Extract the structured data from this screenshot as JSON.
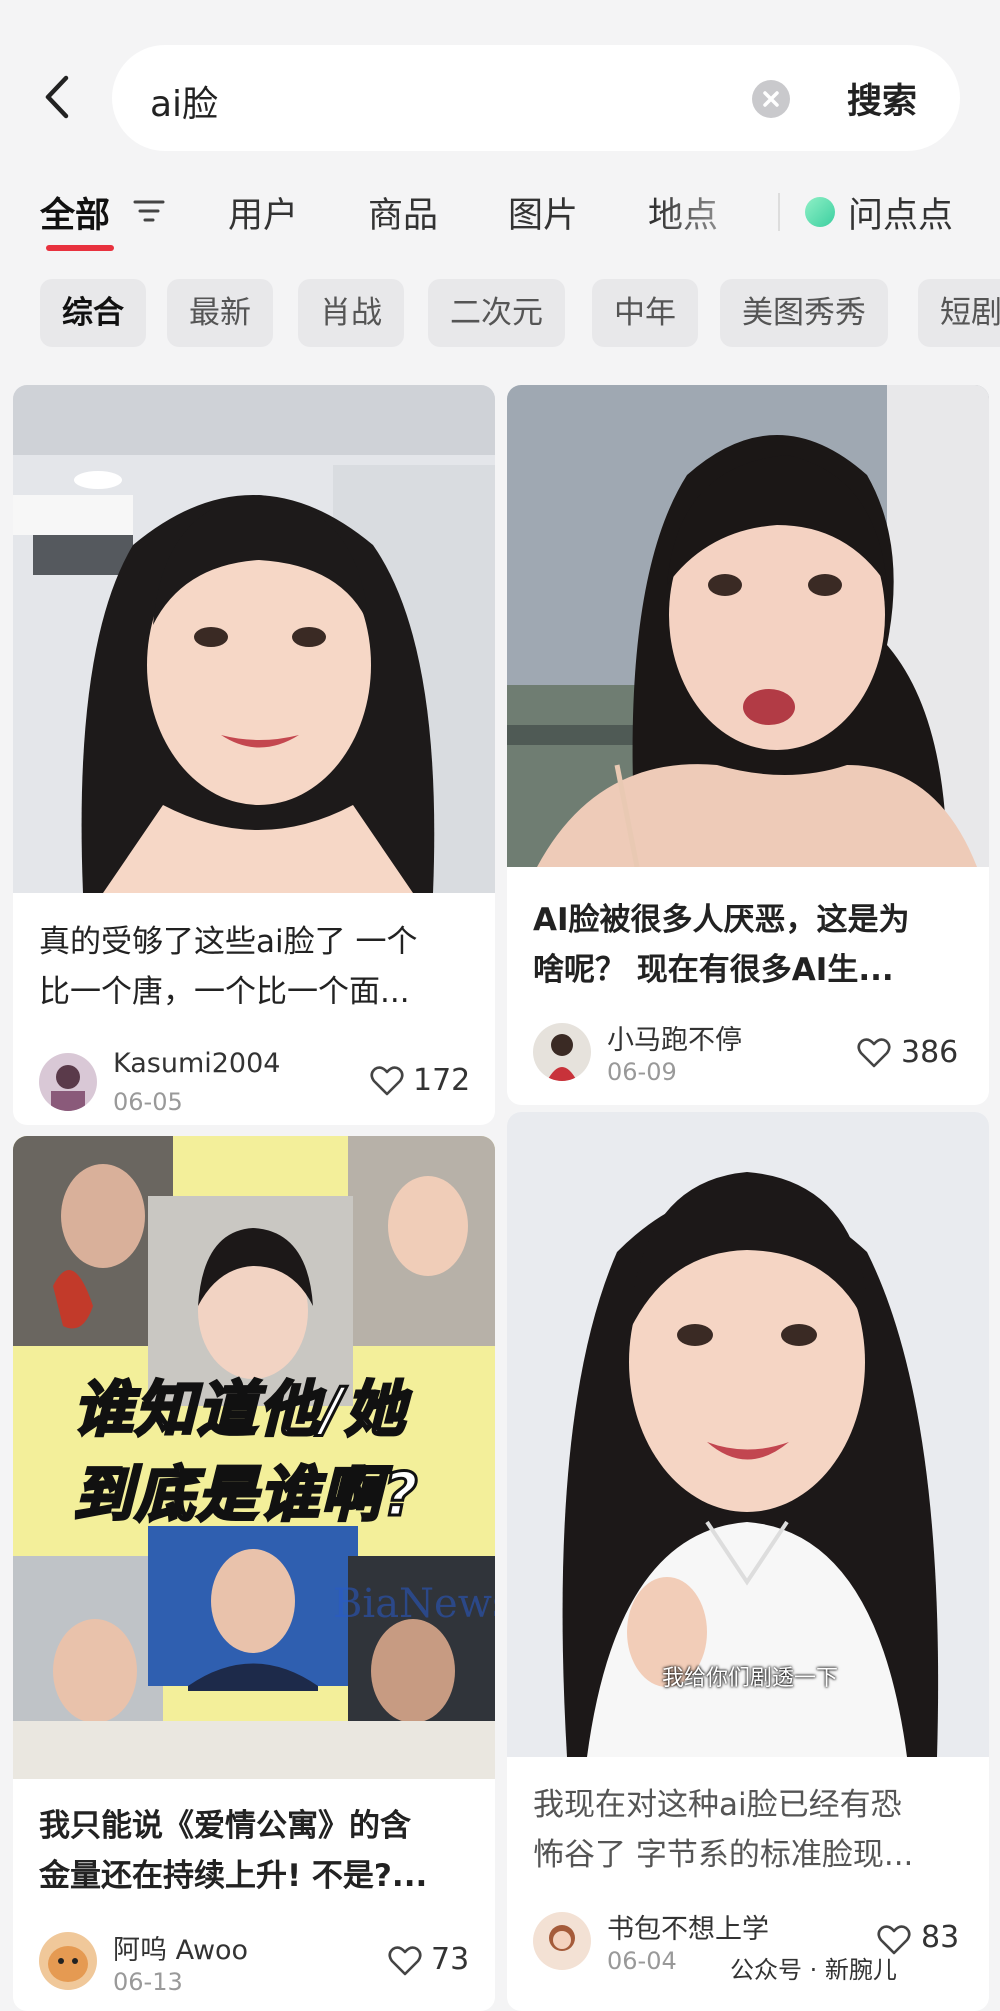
{
  "search": {
    "query": "ai脸",
    "submit_label": "搜索"
  },
  "tabs": [
    {
      "label": "全部",
      "active": true
    },
    {
      "label": "用户"
    },
    {
      "label": "商品"
    },
    {
      "label": "图片"
    },
    {
      "label": "地点"
    },
    {
      "label": "问点点"
    }
  ],
  "chips": [
    {
      "label": "综合",
      "active": true
    },
    {
      "label": "最新"
    },
    {
      "label": "肖战"
    },
    {
      "label": "二次元"
    },
    {
      "label": "中年"
    },
    {
      "label": "美图秀秀"
    },
    {
      "label": "短剧"
    }
  ],
  "cards": [
    {
      "title_line1": "真的受够了这些ai脸了 一个",
      "title_line2": "比一个唐，一个比一个面...",
      "author": "Kasumi2004",
      "date": "06-05",
      "likes": "172"
    },
    {
      "title_line1": "AI脸被很多人厌恶，这是为",
      "title_line2": "啥呢？ 现在有很多AI生...",
      "author": "小马跑不停",
      "date": "06-09",
      "likes": "386"
    },
    {
      "title_line1": "我只能说《爱情公寓》的含",
      "title_line2": "金量还在持续上升! 不是?...",
      "author": "阿呜 Awoo",
      "date": "06-13",
      "likes": "73",
      "image_text_line1": "谁知道他/她",
      "image_text_line2": "到底是谁啊?",
      "watermark": "BiaNews"
    },
    {
      "title_line1": "我现在对这种ai脸已经有恐",
      "title_line2": "怖谷了 字节系的标准脸现...",
      "author": "书包不想上学",
      "date": "06-04",
      "likes": "83",
      "image_caption": "我给你们剧透一下"
    }
  ],
  "footer": {
    "source": "公众号 · 新腕儿"
  },
  "colors": {
    "accent": "#e8313e",
    "background": "#f4f4f5"
  }
}
